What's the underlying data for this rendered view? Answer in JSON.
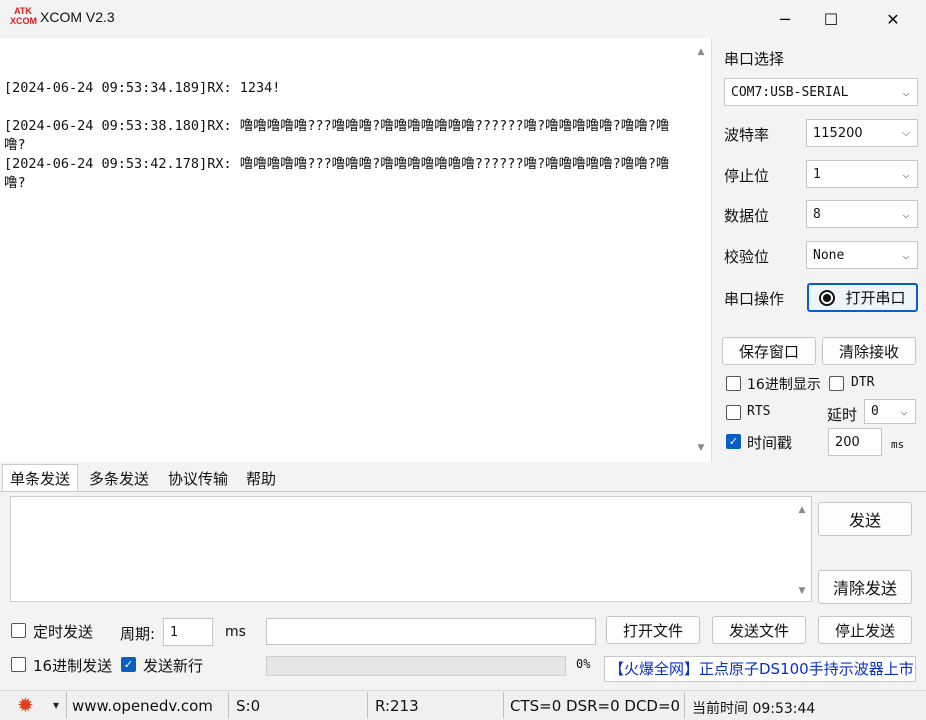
{
  "window": {
    "logo_line1": "ATK",
    "logo_line2": "XCOM",
    "title": "XCOM V2.3",
    "minimize_icon": "─",
    "maximize_icon": "☐",
    "close_icon": "✕"
  },
  "receive": {
    "text": "\n[2024-06-24 09:53:34.189]RX: 1234!\n\n[2024-06-24 09:53:38.180]RX: 噜噜噜噜噜???噜噜噜?噜噜噜噜噜噜噜??????噜?噜噜噜噜噜?噜噜?噜噜?\n[2024-06-24 09:53:42.178]RX: 噜噜噜噜噜???噜噜噜?噜噜噜噜噜噜噜??????噜?噜噜噜噜噜?噜噜?噜噜?"
  },
  "serial": {
    "port_label": "串口选择",
    "port_value": "COM7:USB-SERIAL",
    "baud_label": "波特率",
    "baud_value": "115200",
    "stop_label": "停止位",
    "stop_value": "1",
    "data_label": "数据位",
    "data_value": "8",
    "parity_label": "校验位",
    "parity_value": "None",
    "op_label": "串口操作",
    "open_button": "打开串口"
  },
  "panel": {
    "save_window": "保存窗口",
    "clear_receive": "清除接收",
    "hex_display": "16进制显示",
    "dtr": "DTR",
    "rts": "RTS",
    "delay_label": "延时",
    "delay_value": "0",
    "timestamp": "时间戳",
    "timestamp_value": "200",
    "ms": "ms"
  },
  "tabs": [
    "单条发送",
    "多条发送",
    "协议传输",
    "帮助"
  ],
  "send": {
    "send_button": "发送",
    "clear_send": "清除发送",
    "timed_send": "定时发送",
    "period_label": "周期:",
    "period_value": "1",
    "period_unit": "ms",
    "open_file": "打开文件",
    "send_file": "发送文件",
    "stop_send": "停止发送",
    "hex_send": "16进制发送",
    "send_newline": "发送新行",
    "progress_text": "0%",
    "progress": 0,
    "ad_text": "【火爆全网】正点原子DS100手持示波器上市"
  },
  "status": {
    "gear_icon": "✹",
    "gear_arrow": "▾",
    "website": "www.openedv.com",
    "sent": "S:0",
    "received": "R:213",
    "lines": "CTS=0 DSR=0 DCD=0",
    "time": "当前时间 09:53:44"
  },
  "colors": {
    "accent": "#0a5dc2",
    "ad_text": "#0a2fc9",
    "logo": "#d42020"
  }
}
